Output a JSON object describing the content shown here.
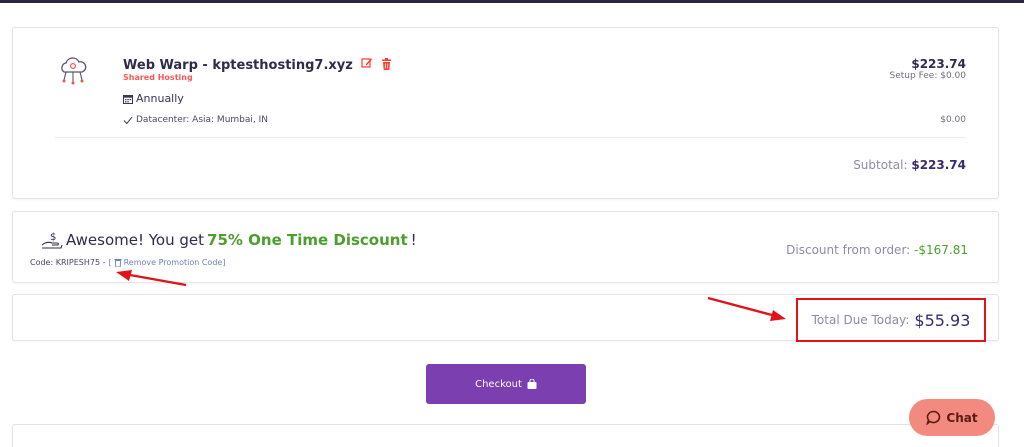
{
  "cart_item": {
    "product_name": "Web Warp - kptesthosting7.xyz",
    "product_group": "Shared Hosting",
    "billing_cycle": "Annually",
    "option_label": "Datacenter: Asia: Mumbai, IN",
    "price": "$223.74",
    "setup_fee": "Setup Fee: $0.00",
    "option_price": "$0.00",
    "subtotal_label": "Subtotal:",
    "subtotal_value": "$223.74"
  },
  "promo": {
    "message_prefix": "Awesome! You get",
    "discount_text": "75% One Time Discount",
    "message_suffix": "!",
    "code_label": "Code: KRIPESH75 -",
    "remove_label": "Remove Promotion Code]",
    "discount_label": "Discount from order:",
    "discount_value": "-$167.81"
  },
  "total": {
    "label": "Total Due Today:",
    "value": "$55.93"
  },
  "checkout_label": "Checkout",
  "chat_label": "Chat",
  "colors": {
    "brand_purple": "#7b3fb0",
    "discount_green": "#4c9e2e",
    "annotation_red": "#e1131a",
    "chat_bg": "#f38a80"
  }
}
